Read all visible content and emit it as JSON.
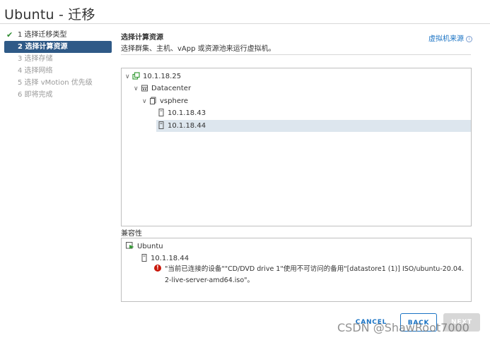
{
  "window": {
    "title": "Ubuntu - 迁移"
  },
  "steps": [
    {
      "label": "1 选择迁移类型",
      "state": "done"
    },
    {
      "label": "2 选择计算资源",
      "state": "active"
    },
    {
      "label": "3 选择存储",
      "state": "pending"
    },
    {
      "label": "4 选择网络",
      "state": "pending"
    },
    {
      "label": "5 选择 vMotion 优先级",
      "state": "pending"
    },
    {
      "label": "6 即将完成",
      "state": "pending"
    }
  ],
  "header": {
    "title": "选择计算资源",
    "description": "选择群集、主机、vApp 或资源池来运行虚拟机。",
    "vm_origin_link": "虚拟机来源"
  },
  "tree": {
    "vcenter": "10.1.18.25",
    "datacenter": "Datacenter",
    "cluster": "vsphere",
    "hosts": [
      "10.1.18.43",
      "10.1.18.44"
    ],
    "selected_host": "10.1.18.44"
  },
  "compatibility": {
    "label": "兼容性",
    "vm": "Ubuntu",
    "host": "10.1.18.44",
    "error": "\"当前已连接的设备\"\"CD/DVD drive 1\"使用不可访问的备用\"[datastore1 (1)] ISO/ubuntu-20.04.2-live-server-amd64.iso\"。"
  },
  "buttons": {
    "cancel": "CANCEL",
    "back": "BACK",
    "next": "NEXT"
  },
  "watermark": "CSDN @ShawRoot7000",
  "colors": {
    "accent": "#1a73c4",
    "active_step": "#2f5a87",
    "error": "#c9190b",
    "success": "#2e8b30",
    "selected_row": "#dde6ee"
  }
}
